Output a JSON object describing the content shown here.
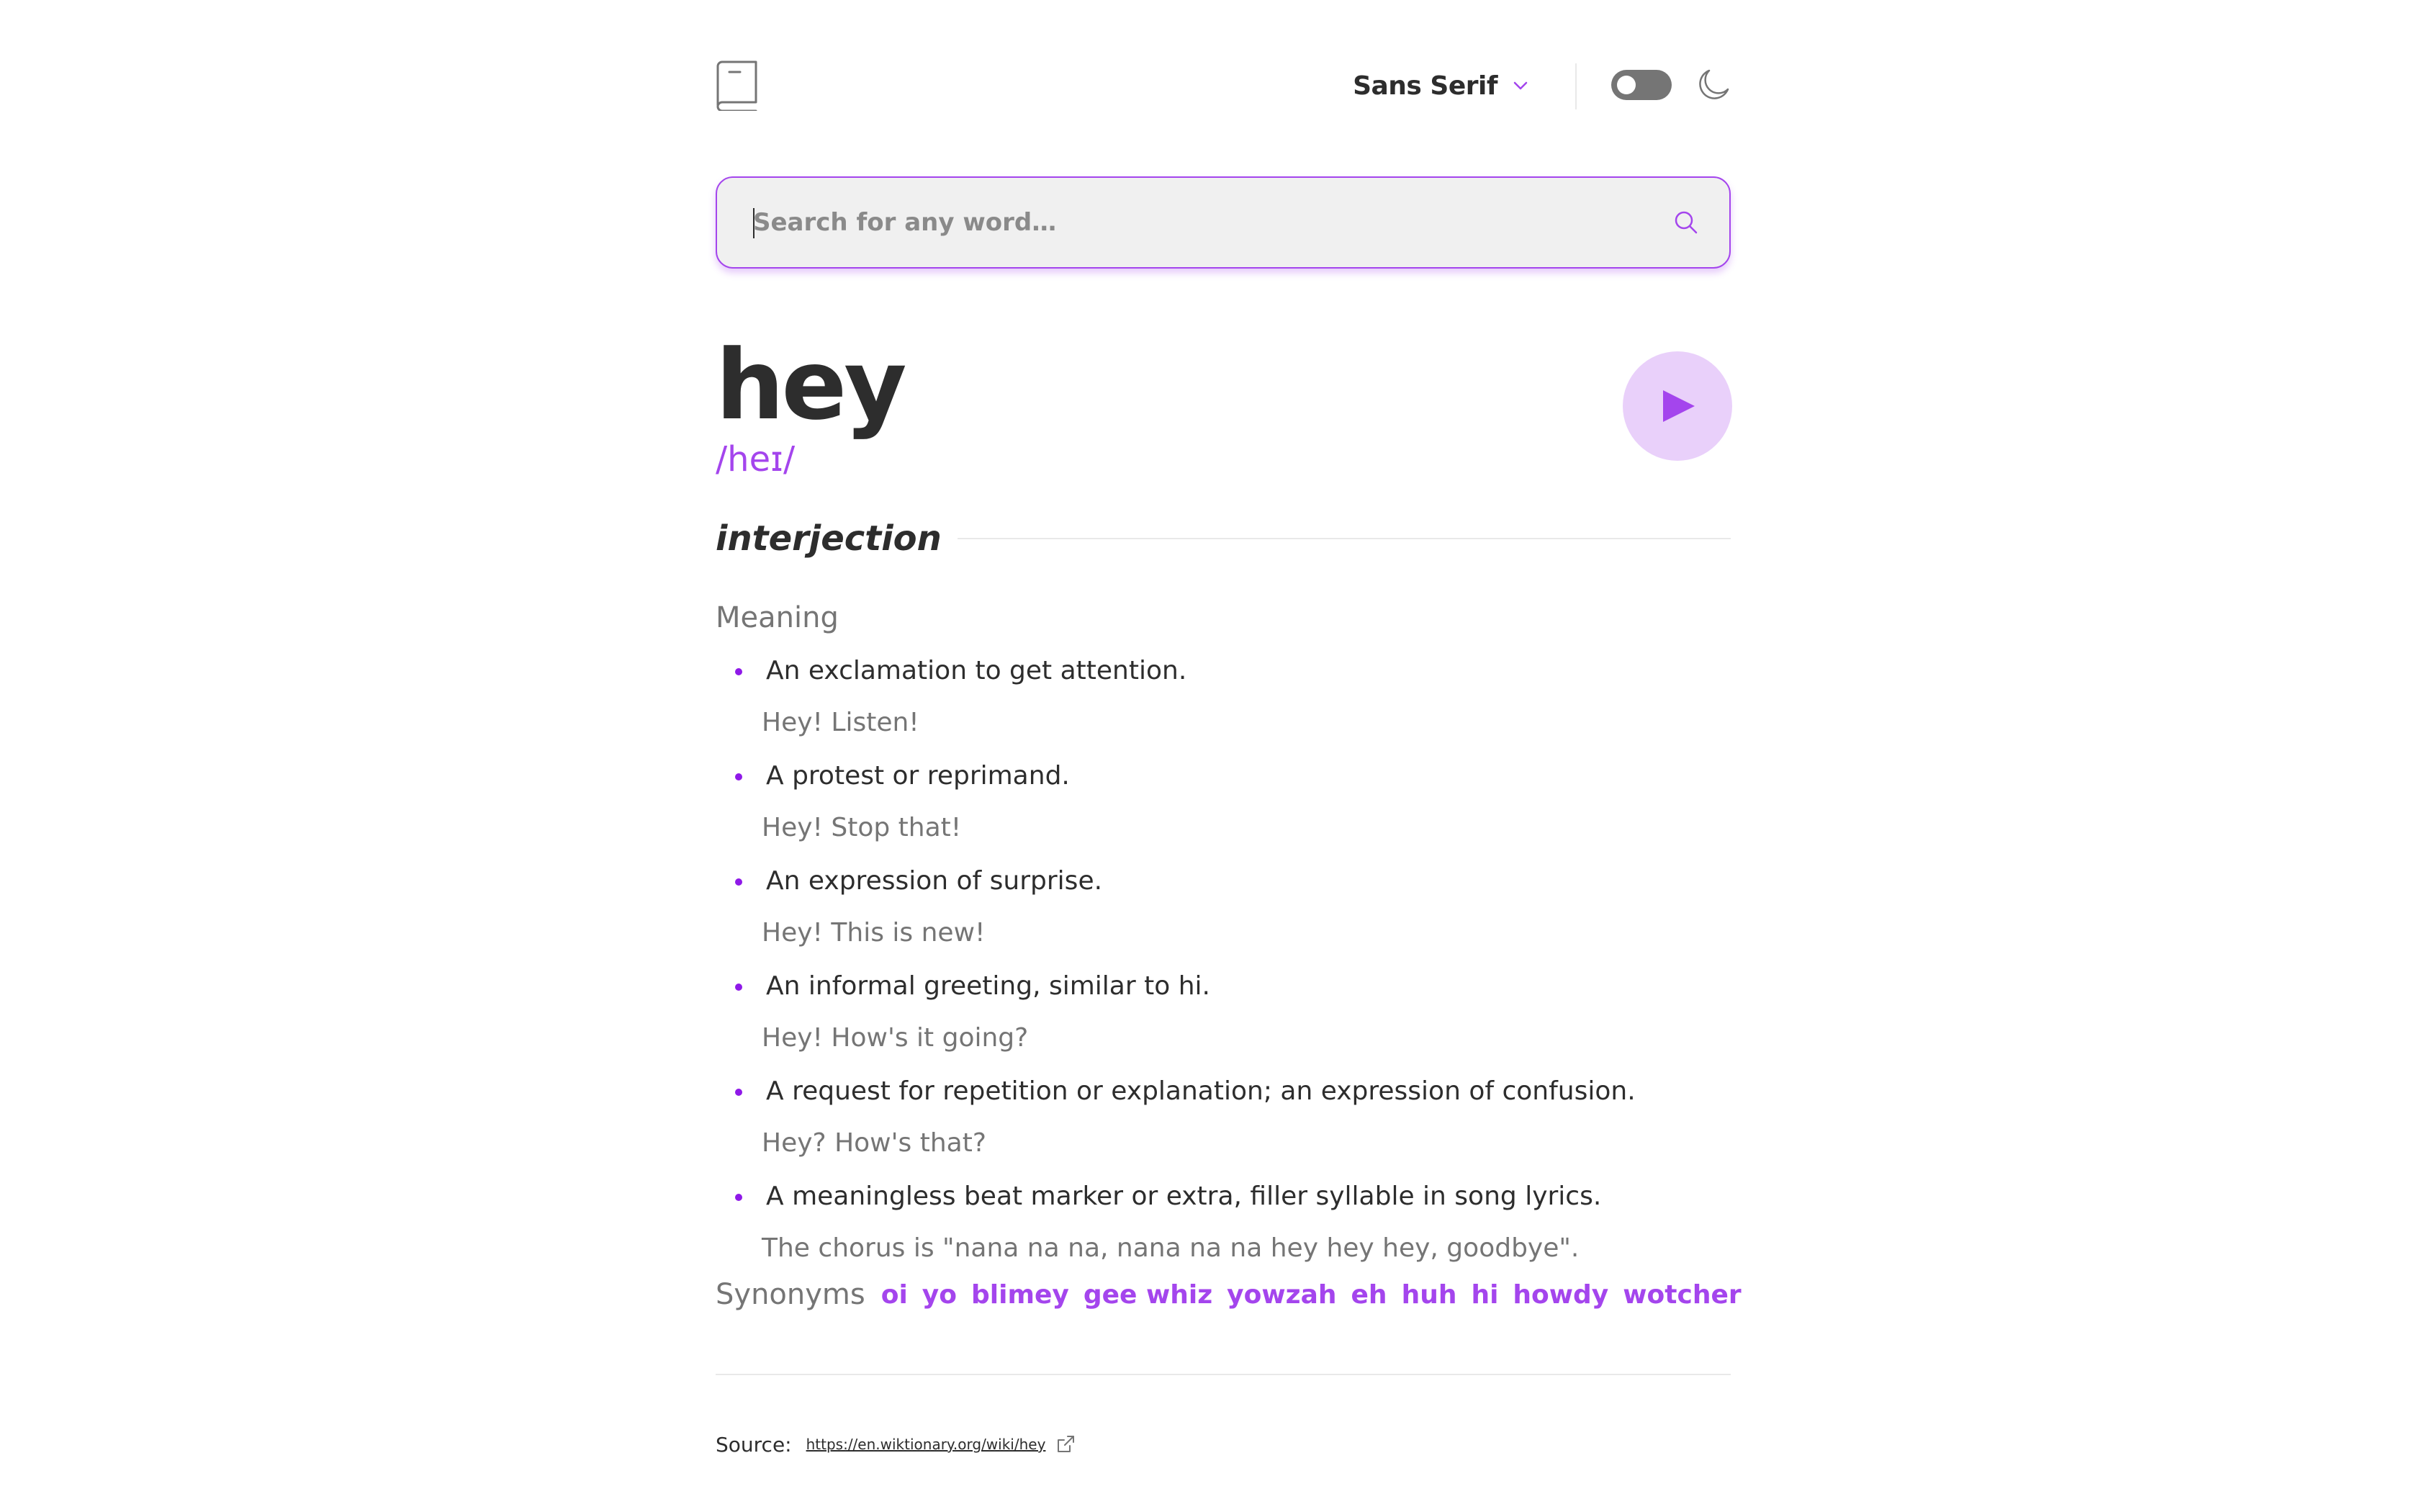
{
  "header": {
    "font_select_label": "Sans Serif",
    "theme_toggle_state": "off",
    "colors": {
      "accent": "#a445ed",
      "text": "#2d2d2d",
      "muted": "#757575",
      "toggle": "#757575",
      "play_bg": "#e9d0fa"
    }
  },
  "search": {
    "placeholder": "Search for any word…",
    "value": ""
  },
  "entry": {
    "word": "hey",
    "phonetic": "/heɪ/",
    "part_of_speech": "interjection",
    "meaning_heading": "Meaning",
    "definitions": [
      {
        "definition": "An exclamation to get attention.",
        "example": "Hey! Listen!"
      },
      {
        "definition": "A protest or reprimand.",
        "example": "Hey! Stop that!"
      },
      {
        "definition": "An expression of surprise.",
        "example": "Hey! This is new!"
      },
      {
        "definition": "An informal greeting, similar to hi.",
        "example": "Hey! How's it going?"
      },
      {
        "definition": "A request for repetition or explanation; an expression of confusion.",
        "example": "Hey? How's that?"
      },
      {
        "definition": "A meaningless beat marker or extra, filler syllable in song lyrics.",
        "example": "The chorus is \"nana na na, nana na na hey hey hey, goodbye\"."
      }
    ],
    "synonyms_label": "Synonyms",
    "synonyms": [
      "oi",
      "yo",
      "blimey",
      "gee whiz",
      "yowzah",
      "eh",
      "huh",
      "hi",
      "howdy",
      "wotcher"
    ]
  },
  "source": {
    "label": "Source:",
    "url": "https://en.wiktionary.org/wiki/hey"
  },
  "icons": {
    "logo": "book-icon",
    "font_chevron": "chevron-down-icon",
    "theme": "moon-icon",
    "search": "search-icon",
    "play": "play-icon",
    "external": "external-link-icon"
  }
}
